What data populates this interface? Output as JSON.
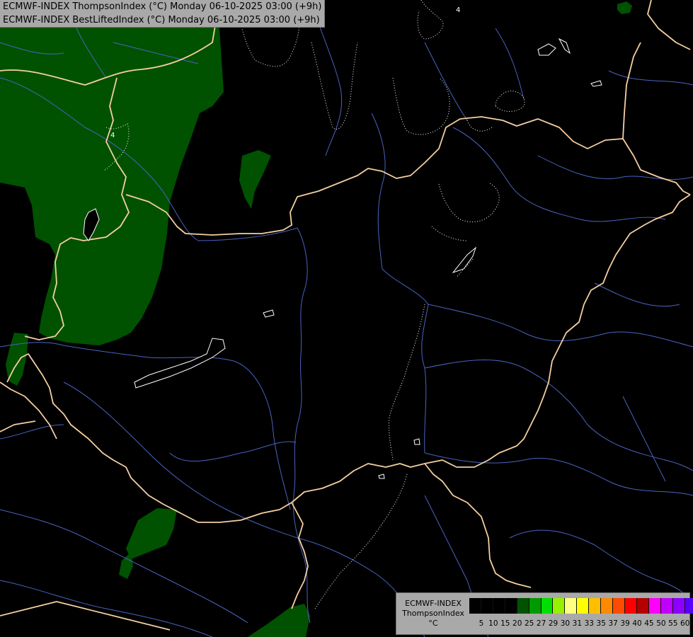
{
  "map": {
    "titles": [
      "ECMWF-INDEX ThompsonIndex (°C) Monday 06-10-2025 03:00 (+9h)",
      "ECMWF-INDEX BestLiftedIndex (°C) Monday 06-10-2025 03:00 (+9h)"
    ],
    "contour_labels": [
      "4",
      "4"
    ],
    "colors": {
      "background": "#000000",
      "thompson_fill": "#005200",
      "borders": "#f5cfa0",
      "rivers": "#4a63c0",
      "lakes": "#ffffff",
      "lifted_contour": "#ffffff"
    }
  },
  "legend": {
    "model": "ECMWF-INDEX",
    "parameter": "ThompsonIndex",
    "unit": "°C",
    "colors": [
      "#000000",
      "#000000",
      "#000000",
      "#000000",
      "#005200",
      "#009a00",
      "#00e000",
      "#96f000",
      "#ffff80",
      "#ffff00",
      "#ffbe00",
      "#ff8a00",
      "#ff4b00",
      "#ff0000",
      "#b40000",
      "#ff00ff",
      "#c000ff",
      "#8c00ff",
      "#5a00ff",
      "#0000ff"
    ],
    "ticks": [
      "5",
      "10",
      "15",
      "20",
      "25",
      "27",
      "29",
      "30",
      "31",
      "33",
      "35",
      "37",
      "39",
      "40",
      "45",
      "50",
      "55",
      "60"
    ]
  }
}
